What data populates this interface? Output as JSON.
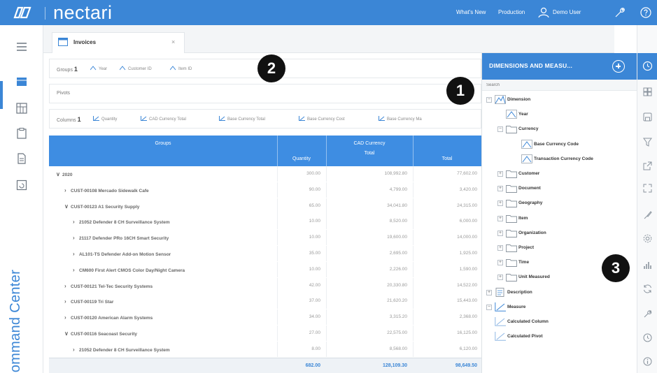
{
  "topbar": {
    "brand": "nectari",
    "links": [
      "What's New",
      "Production",
      "Demo User"
    ]
  },
  "leftrail": {
    "label": "Command Center"
  },
  "tab": {
    "label": "Invoices",
    "close": "×"
  },
  "wells": {
    "groups_label": "Groups",
    "groups_count": "1",
    "groups": [
      "Year",
      "Customer ID",
      "Item ID"
    ],
    "pivots_label": "Pivots",
    "columns_label": "Columns",
    "columns_count": "1",
    "columns": [
      "Quantity",
      "CAD Currency Total",
      "Base Currency Total",
      "Base Currency Cost",
      "Base Currency Ma"
    ]
  },
  "grid": {
    "headers": {
      "groups": "Groups",
      "quantity": "Quantity",
      "cad": "CAD Currency",
      "cad_total": "Total",
      "total": "Total"
    },
    "rows": [
      {
        "depth": 0,
        "chev": "∨",
        "label": "2020",
        "qty": "300.00",
        "cad": "108,992.80",
        "total": "77,602.00"
      },
      {
        "depth": 1,
        "chev": "›",
        "label": "CUST-00108 Mercado Sidewalk Cafe",
        "qty": "90.00",
        "cad": "4,799.00",
        "total": "3,420.00"
      },
      {
        "depth": 1,
        "chev": "∨",
        "label": "CUST-00123 A1 Security Supply",
        "qty": "65.00",
        "cad": "34,041.80",
        "total": "24,315.00"
      },
      {
        "depth": 2,
        "chev": "›",
        "label": "21052 Defender 8 CH Surveillance System",
        "qty": "10.00",
        "cad": "8,520.00",
        "total": "6,000.00"
      },
      {
        "depth": 2,
        "chev": "›",
        "label": "21117 Defender PRo 16CH Smart Security",
        "qty": "10.00",
        "cad": "19,600.00",
        "total": "14,000.00"
      },
      {
        "depth": 2,
        "chev": "›",
        "label": "AL101-TS Defender Add-on Motion Sensor",
        "qty": "35.00",
        "cad": "2,695.00",
        "total": "1,925.00"
      },
      {
        "depth": 2,
        "chev": "›",
        "label": "CM600 First Alert CMOS Color Day/Night Camera",
        "qty": "10.00",
        "cad": "2,226.00",
        "total": "1,590.00"
      },
      {
        "depth": 1,
        "chev": "›",
        "label": "CUST-00121 Tel-Tec Security Systems",
        "qty": "42.00",
        "cad": "20,330.80",
        "total": "14,522.00"
      },
      {
        "depth": 1,
        "chev": "›",
        "label": "CUST-00119 Tri Star",
        "qty": "37.00",
        "cad": "21,620.20",
        "total": "15,443.00"
      },
      {
        "depth": 1,
        "chev": "›",
        "label": "CUST-00120 American Alarm Systems",
        "qty": "34.00",
        "cad": "3,315.20",
        "total": "2,368.00"
      },
      {
        "depth": 1,
        "chev": "∨",
        "label": "CUST-00116 Seacoast Security",
        "qty": "27.00",
        "cad": "22,575.00",
        "total": "16,125.00"
      },
      {
        "depth": 2,
        "chev": "›",
        "label": "21052 Defender 8 CH Surveillance System",
        "qty": "8.00",
        "cad": "8,568.00",
        "total": "6,120.00"
      }
    ],
    "footer": {
      "qty": "682.00",
      "cad": "128,109.30",
      "total": "98,649.50"
    }
  },
  "dimensions": {
    "title": "DIMENSIONS AND MEASU...",
    "search_placeholder": "Search",
    "nodes": [
      {
        "indent": 0,
        "tog": "−",
        "icon": "dimension-icon",
        "label": "Dimension"
      },
      {
        "indent": 1,
        "tog": "",
        "icon": "attribute-icon",
        "label": "Year"
      },
      {
        "indent": 1,
        "tog": "−",
        "icon": "folder-icon",
        "label": "Currency"
      },
      {
        "indent": 2,
        "tog": "",
        "icon": "attribute-icon",
        "label": "Base Currency Code"
      },
      {
        "indent": 2,
        "tog": "",
        "icon": "attribute-icon",
        "label": "Transaction Currency Code"
      },
      {
        "indent": 1,
        "tog": "+",
        "icon": "folder-icon",
        "label": "Customer"
      },
      {
        "indent": 1,
        "tog": "+",
        "icon": "folder-icon",
        "label": "Document"
      },
      {
        "indent": 1,
        "tog": "+",
        "icon": "folder-icon",
        "label": "Geography"
      },
      {
        "indent": 1,
        "tog": "+",
        "icon": "folder-icon",
        "label": "Item"
      },
      {
        "indent": 1,
        "tog": "+",
        "icon": "folder-icon",
        "label": "Organization"
      },
      {
        "indent": 1,
        "tog": "+",
        "icon": "folder-icon",
        "label": "Project"
      },
      {
        "indent": 1,
        "tog": "+",
        "icon": "folder-icon",
        "label": "Time"
      },
      {
        "indent": 1,
        "tog": "+",
        "icon": "folder-icon",
        "label": "Unit Measured"
      },
      {
        "indent": 0,
        "tog": "+",
        "icon": "description-icon",
        "label": "Description"
      },
      {
        "indent": 0,
        "tog": "−",
        "icon": "measure-icon",
        "label": "Measure"
      },
      {
        "indent": 0,
        "tog": "",
        "icon": "calc-icon",
        "label": "Calculated Column"
      },
      {
        "indent": 0,
        "tog": "",
        "icon": "calc-icon",
        "label": "Calculated Pivot"
      }
    ]
  },
  "callouts": [
    "1",
    "2",
    "3"
  ],
  "colors": {
    "accent": "#3b86d6",
    "header": "#3e8de2"
  }
}
